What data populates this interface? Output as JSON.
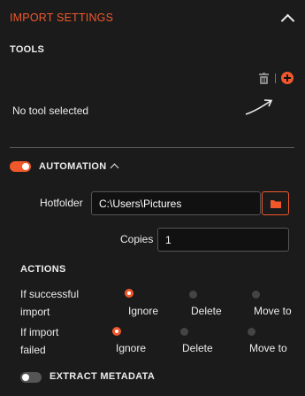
{
  "header": {
    "title": "IMPORT SETTINGS"
  },
  "tools": {
    "label": "TOOLS",
    "empty_text": "No tool selected"
  },
  "automation": {
    "label": "AUTOMATION",
    "enabled": true,
    "hotfolder_label": "Hotfolder",
    "hotfolder_value": "C:\\Users\\Pictures",
    "copies_label": "Copies",
    "copies_value": "1"
  },
  "actions": {
    "label": "ACTIONS",
    "rows": [
      {
        "label_line1": "If successful",
        "label_line2": "import",
        "options": [
          "Ignore",
          "Delete",
          "Move to"
        ],
        "selected": "Ignore"
      },
      {
        "label_line1": "If import",
        "label_line2": "failed",
        "options": [
          "Ignore",
          "Delete",
          "Move to"
        ],
        "selected": "Ignore"
      }
    ]
  },
  "extract_metadata": {
    "label": "EXTRACT METADATA",
    "enabled": false
  },
  "colors": {
    "accent": "#f0582b",
    "background": "#1b1b1b",
    "field": "#111111"
  },
  "icons": [
    "chevron-up-icon",
    "trash-icon",
    "plus-icon",
    "arrow-icon",
    "folder-icon"
  ]
}
